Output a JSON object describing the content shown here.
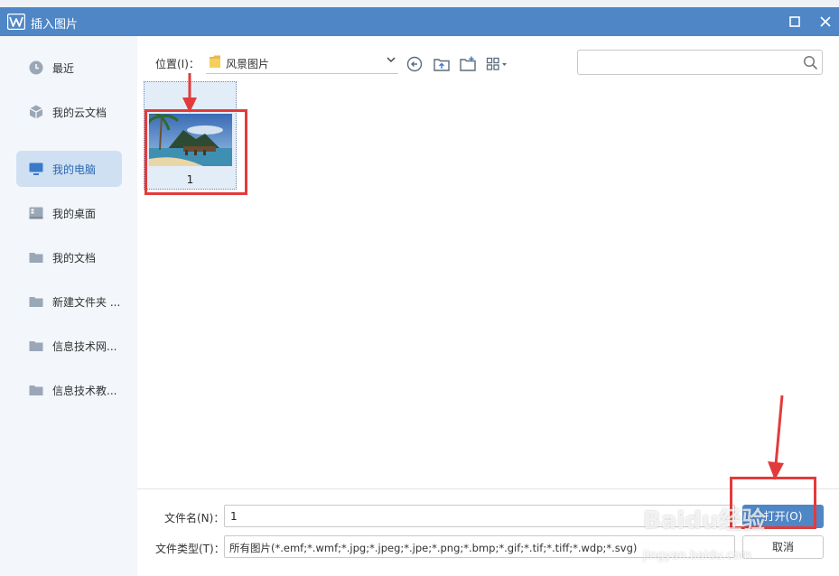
{
  "window": {
    "title": "插入图片"
  },
  "sidebar": {
    "items": [
      {
        "label": "最近",
        "icon": "clock-icon"
      },
      {
        "label": "我的云文档",
        "icon": "cloud-cube-icon"
      },
      {
        "label": "我的电脑",
        "icon": "monitor-icon",
        "active": true
      },
      {
        "label": "我的桌面",
        "icon": "desktop-icon"
      },
      {
        "label": "我的文档",
        "icon": "folder-icon"
      },
      {
        "label": "新建文件夹 ...",
        "icon": "folder-icon"
      },
      {
        "label": "信息技术网...",
        "icon": "folder-icon"
      },
      {
        "label": "信息技术教...",
        "icon": "folder-icon"
      }
    ]
  },
  "toolbar": {
    "location_label": "位置(I)：",
    "location_value": "风景图片",
    "search_placeholder": ""
  },
  "files": [
    {
      "name": "1",
      "type": "image"
    }
  ],
  "form": {
    "filename_label": "文件名(N)：",
    "filename_value": "1",
    "filetype_label": "文件类型(T)：",
    "filetype_value": "所有图片(*.emf;*.wmf;*.jpg;*.jpeg;*.jpe;*.png;*.bmp;*.gif;*.tif;*.tiff;*.wdp;*.svg)"
  },
  "buttons": {
    "open": "打开(O)",
    "cancel": "取消"
  },
  "watermark": {
    "text": "Baidu经验",
    "sub": "jingyan.baidu.com"
  },
  "colors": {
    "accent": "#4f86c6",
    "sidebar_bg": "#f3f6fa",
    "active_item": "#cfe0f3",
    "annotation": "#e23b3b"
  }
}
